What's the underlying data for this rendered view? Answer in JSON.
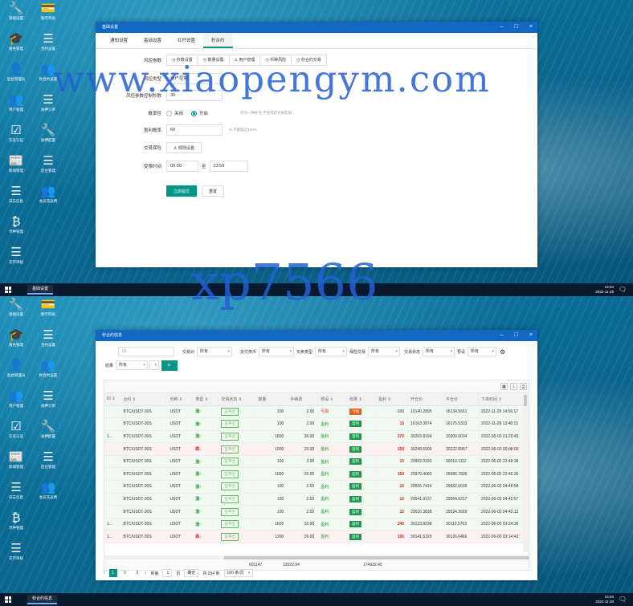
{
  "desktop_icons_top": [
    {
      "label": "基础设置",
      "icon": "wrench-icon",
      "glyph": "🔧"
    },
    {
      "label": "图币列表",
      "icon": "card-icon",
      "glyph": "💳"
    },
    {
      "label": "角色管理",
      "icon": "graduation-icon",
      "glyph": "🎓"
    },
    {
      "label": "合约设置",
      "icon": "list-icon",
      "glyph": "☰"
    },
    {
      "label": "后台管理员",
      "icon": "user-icon",
      "glyph": "👤"
    },
    {
      "label": "秒合约设置",
      "icon": "add-user-icon",
      "glyph": "👥"
    },
    {
      "label": "用户管理",
      "icon": "users-icon",
      "glyph": "👥"
    },
    {
      "label": "质押订单",
      "icon": "list-icon",
      "glyph": "☰"
    },
    {
      "label": "实名认证",
      "icon": "check-icon",
      "glyph": "☑"
    },
    {
      "label": "质押配置",
      "icon": "wrench-icon",
      "glyph": "🔧"
    },
    {
      "label": "新闻管理",
      "icon": "news-icon",
      "glyph": "📰"
    },
    {
      "label": "后台管理",
      "icon": "list-icon",
      "glyph": "☰"
    },
    {
      "label": "日志信息",
      "icon": "list-icon",
      "glyph": "☰"
    },
    {
      "label": "会员充返费",
      "icon": "add-user-icon",
      "glyph": "👥"
    },
    {
      "label": "币种管理",
      "icon": "bitcoin-icon",
      "glyph": "₿"
    },
    {
      "label": "",
      "icon": "",
      "glyph": ""
    },
    {
      "label": "充币审核",
      "icon": "list-icon",
      "glyph": "☰"
    }
  ],
  "desktop_icons_bottom": [
    {
      "label": "基础设置",
      "icon": "wrench-icon",
      "glyph": "🔧"
    },
    {
      "label": "图币列表",
      "icon": "card-icon",
      "glyph": "💳"
    },
    {
      "label": "角色管理",
      "icon": "graduation-icon",
      "glyph": "🎓"
    },
    {
      "label": "合约设置",
      "icon": "list-icon",
      "glyph": "☰"
    },
    {
      "label": "后台管理员",
      "icon": "user-icon",
      "glyph": "👤"
    },
    {
      "label": "秒合约设置",
      "icon": "add-user-icon",
      "glyph": "👥"
    },
    {
      "label": "用户管理",
      "icon": "users-icon",
      "glyph": "👥"
    },
    {
      "label": "质押订单",
      "icon": "list-icon",
      "glyph": "☰"
    },
    {
      "label": "实名认证",
      "icon": "check-icon",
      "glyph": "☑"
    },
    {
      "label": "质押配置",
      "icon": "wrench-icon",
      "glyph": "🔧"
    },
    {
      "label": "新闻管理",
      "icon": "news-icon",
      "glyph": "📰"
    },
    {
      "label": "后台管理",
      "icon": "list-icon",
      "glyph": "☰"
    },
    {
      "label": "日志信息",
      "icon": "list-icon",
      "glyph": "☰"
    },
    {
      "label": "会员充返费",
      "icon": "add-user-icon",
      "glyph": "👥"
    },
    {
      "label": "币种管理",
      "icon": "bitcoin-icon",
      "glyph": "₿"
    },
    {
      "label": "",
      "icon": "",
      "glyph": ""
    },
    {
      "label": "充币审核",
      "icon": "list-icon",
      "glyph": "☰"
    }
  ],
  "window1": {
    "title": "基础设置",
    "tabs": [
      "通知设置",
      "基础设置",
      "杠杆设置",
      "秒合约"
    ],
    "active_tab": 3,
    "rows": {
      "risk_label": "风控参数",
      "sub_tabs": [
        "◷ 秒数设置",
        "◷ 数量设置",
        "♙ 用户管理",
        "◷ 币种风险",
        "◷ 秒合约交易"
      ],
      "risk_type_label": "风控类型",
      "risk_type_value": "用户控制",
      "risk_param_label": "风控参数控制秒数",
      "risk_param_value": "30",
      "prob_label": "概率性",
      "radio_off": "关闭",
      "radio_on": "开启",
      "prob_hint": "作为一种补充,不受风控开关影响",
      "profit_label": "盈利概率",
      "profit_value": "60",
      "profit_hint": "%   不能超过100%",
      "risk_btn_label": "交易保险",
      "risk_btn": "♙ 规则设置",
      "time_label": "受限时间",
      "time_from": "00:00",
      "time_sep": "至",
      "time_to": "23:59",
      "submit": "立即提交",
      "reset": "重置"
    }
  },
  "window2": {
    "title": "秒合约信息",
    "filters": {
      "id_placeholder": "ID",
      "f1_label": "交易对",
      "f1_value": "所有",
      "f2_label": "支付类币",
      "f2_value": "所有",
      "f3_label": "买卖类型",
      "f3_value": "所有",
      "f4_label": "保险交易",
      "f4_value": "所有",
      "f5_label": "交易状态",
      "f5_value": "所有",
      "f6_label": "预设",
      "f6_value": "所有",
      "f7_label": "结果",
      "f7_value": "所有"
    },
    "columns": [
      "ID ⇕",
      "合约 ⇕",
      "币种 ⇕",
      "类型 ⇕",
      "交易状态 ⇕",
      "数量",
      "手续费",
      "预设 ⇕",
      "结果 ⇕",
      "盈利 ⇕",
      "开仓价",
      "平仓价",
      "下单时间 ⇕"
    ],
    "rows": [
      {
        "id": "",
        "pair": "BTC/USDT-30S",
        "coin": "USDT",
        "type": "涨↑",
        "dir": "up",
        "status": "已平仓",
        "qty": "100",
        "fee": "2.00",
        "preset": "亏损",
        "preset_cls": "lose",
        "result": "亏损",
        "res_cls": "l",
        "profit": "-100",
        "pcls": "neg",
        "open": "16140.2895",
        "close": "16134.5661",
        "time": "2022-11-28 14:56:17",
        "row": "r-green"
      },
      {
        "id": "",
        "pair": "BTC/USDT-30S",
        "coin": "USDT",
        "type": "涨↑",
        "dir": "up",
        "status": "已平仓",
        "qty": "100",
        "fee": "2.00",
        "preset": "盈利",
        "preset_cls": "win-ok",
        "result": "盈利",
        "res_cls": "",
        "profit": "15",
        "pcls": "",
        "open": "16163.3874",
        "close": "16175.5333",
        "time": "2022-11-28 13:48:15",
        "row": "r-green"
      },
      {
        "id": "1...",
        "pair": "BTC/USDT-30S",
        "coin": "USDT",
        "type": "涨↑",
        "dir": "up",
        "status": "已平仓",
        "qty": "1800",
        "fee": "36.00",
        "preset": "盈利",
        "preset_cls": "win-ok",
        "result": "盈利",
        "res_cls": "",
        "profit": "270",
        "pcls": "",
        "open": "30203.8194",
        "close": "30209.9034",
        "time": "2022-06-03 01:29:49",
        "row": "r-green"
      },
      {
        "id": "",
        "pair": "BTC/USDT-30S",
        "coin": "USDT",
        "type": "跌↓",
        "dir": "dn",
        "status": "已平仓",
        "qty": "1000",
        "fee": "20.00",
        "preset": "盈利",
        "preset_cls": "win-ok",
        "result": "盈利",
        "res_cls": "",
        "profit": "150",
        "pcls": "",
        "open": "30248.6905",
        "close": "30222.8967",
        "time": "2022-06-03 00:08:00",
        "row": "r-red"
      },
      {
        "id": "",
        "pair": "BTC/USDT-30S",
        "coin": "USDT",
        "type": "涨↑",
        "dir": "up",
        "status": "已平仓",
        "qty": "100",
        "fee": "2.00",
        "preset": "盈利",
        "preset_cls": "win-ok",
        "result": "盈利",
        "res_cls": "",
        "profit": "15",
        "pcls": "",
        "open": "29992.0193",
        "close": "30010.1112",
        "time": "2022-06-02 22:48:38",
        "row": "r-green"
      },
      {
        "id": "",
        "pair": "BTC/USDT-30S",
        "coin": "USDT",
        "type": "涨↑",
        "dir": "up",
        "status": "已平仓",
        "qty": "1000",
        "fee": "20.00",
        "preset": "盈利",
        "preset_cls": "win-ok",
        "result": "盈利",
        "res_cls": "",
        "profit": "150",
        "pcls": "",
        "open": "29979.4683",
        "close": "29986.7836",
        "time": "2022-06-02 22:46:35",
        "row": "r-green"
      },
      {
        "id": "",
        "pair": "BTC/USDT-30S",
        "coin": "USDT",
        "type": "涨↑",
        "dir": "up",
        "status": "已平仓",
        "qty": "100",
        "fee": "2.00",
        "preset": "盈利",
        "preset_cls": "win-ok",
        "result": "盈利",
        "res_cls": "",
        "profit": "15",
        "pcls": "",
        "open": "29556.7414",
        "close": "29582.0639",
        "time": "2022-06-02 04:48:58",
        "row": "r-green"
      },
      {
        "id": "",
        "pair": "BTC/USDT-30S",
        "coin": "USDT",
        "type": "涨↑",
        "dir": "up",
        "status": "已平仓",
        "qty": "100",
        "fee": "2.00",
        "preset": "盈利",
        "preset_cls": "win-ok",
        "result": "盈利",
        "res_cls": "",
        "profit": "15",
        "pcls": "",
        "open": "29541.9137",
        "close": "29564.9217",
        "time": "2022-06-02 04:45:57",
        "row": "r-green"
      },
      {
        "id": "",
        "pair": "BTC/USDT-30S",
        "coin": "USDT",
        "type": "涨↑",
        "dir": "up",
        "status": "已平仓",
        "qty": "100",
        "fee": "2.00",
        "preset": "盈利",
        "preset_cls": "win-ok",
        "result": "盈利",
        "res_cls": "",
        "profit": "15",
        "pcls": "",
        "open": "29516.3838",
        "close": "29524.3669",
        "time": "2022-06-02 04:45:12",
        "row": "r-green"
      },
      {
        "id": "1...",
        "pair": "BTC/USDT-30S",
        "coin": "USDT",
        "type": "涨↑",
        "dir": "up",
        "status": "已平仓",
        "qty": "1600",
        "fee": "32.00",
        "preset": "盈利",
        "preset_cls": "win-ok",
        "result": "盈利",
        "res_cls": "",
        "profit": "240",
        "pcls": "",
        "open": "30133.8238",
        "close": "30119.5703",
        "time": "2022-06-02 03:24:36",
        "row": "r-green"
      },
      {
        "id": "1...",
        "pair": "BTC/USDT-30S",
        "coin": "USDT",
        "type": "跌↓",
        "dir": "dn",
        "status": "已平仓",
        "qty": "1300",
        "fee": "26.00",
        "preset": "盈利",
        "preset_cls": "win-ok",
        "result": "盈利",
        "res_cls": "",
        "profit": "195",
        "pcls": "",
        "open": "30141.6329",
        "close": "30126.6466",
        "time": "2022-06-02 03:14:43",
        "row": "r-red"
      }
    ],
    "totals": {
      "qty": "601147",
      "fee": "12022.94",
      "profit": "174922.45"
    },
    "pager": {
      "pages": [
        "1",
        "2",
        "3"
      ],
      "current": "1",
      "goto_label": "到第",
      "goto_value": "1",
      "page_unit": "页",
      "confirm": "确定",
      "total": "共 294 条",
      "per_page": "100 条/页"
    }
  },
  "taskbar_top": {
    "app": "基础设置",
    "time": "14:04",
    "date": "2022-11-28"
  },
  "taskbar_bottom": {
    "app": "秒合约信息",
    "time": "14:04",
    "date": "2022-11-28"
  },
  "watermarks": {
    "top": "www.xiaopengym.com",
    "mid": "xp7566"
  }
}
